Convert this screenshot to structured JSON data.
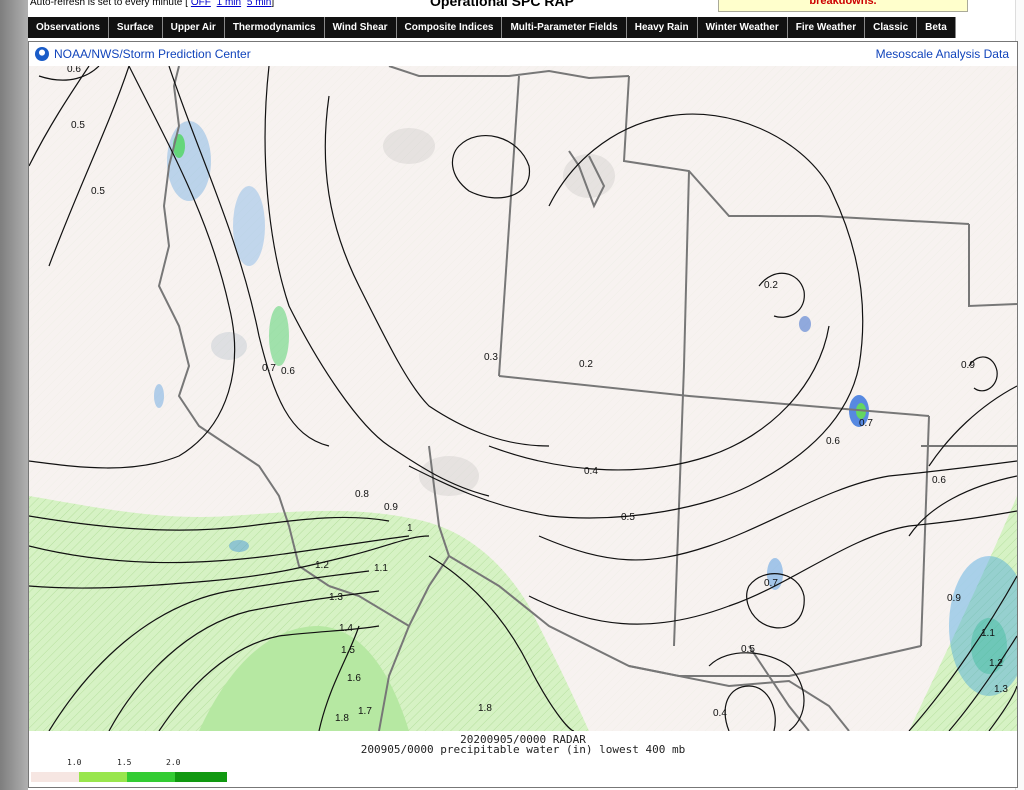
{
  "toolbar": {
    "refresh_text": "Auto-refresh is set to every minute",
    "refresh_links": [
      "OFF",
      "1 min",
      "5 min"
    ],
    "page_title": "Operational SPC RAP",
    "notice": "breakdowns."
  },
  "nav": {
    "tabs": [
      "Observations",
      "Surface",
      "Upper Air",
      "Thermodynamics",
      "Wind Shear",
      "Composite Indices",
      "Multi-Parameter Fields",
      "Heavy Rain",
      "Winter Weather",
      "Fire Weather",
      "Classic",
      "Beta"
    ]
  },
  "map": {
    "organization": "NOAA/NWS/Storm Prediction Center",
    "dataset": "Mesoscale Analysis Data",
    "radar_time": "20200905/0000 RADAR",
    "field_caption": "200905/0000 precipitable water (in) lowest 400 mb",
    "contour_labels": [
      "0.6",
      "0.5",
      "0.5",
      "0.7",
      "0.6",
      "0.3",
      "0.2",
      "0.2",
      "0.9",
      "0.6",
      "0.7",
      "0.4",
      "0.5",
      "0.8",
      "0.9",
      "1",
      "1.1",
      "1.2",
      "1.3",
      "1.4",
      "1.5",
      "1.6",
      "1.7",
      "1.8",
      "1.8",
      "0.6",
      "0.7",
      "0.9",
      "0.5",
      "0.4",
      "1.1",
      "1.2",
      "1.3"
    ]
  },
  "legend": {
    "ticks": [
      "1.0",
      "1.5",
      "2.0"
    ],
    "colors": [
      "#f6e6e2",
      "#99e64d",
      "#33cc33",
      "#119911"
    ]
  },
  "colors": {
    "land": "#f7f2f0",
    "pw_moist": "#d6f2c4",
    "pw_moister": "#b6e8a2",
    "contour": "#111111",
    "boundary": "#777777",
    "link": "#1144bb"
  }
}
